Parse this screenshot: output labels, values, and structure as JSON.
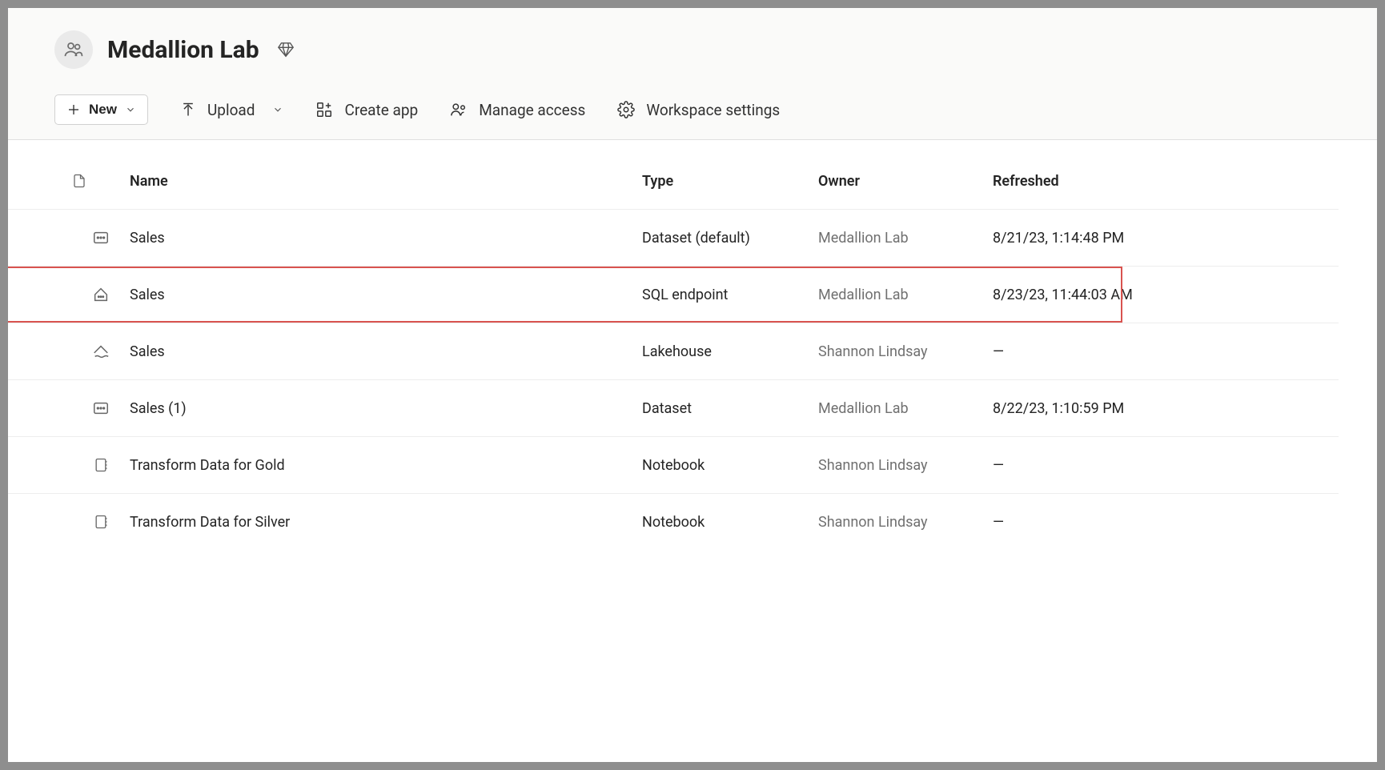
{
  "workspace": {
    "title": "Medallion Lab"
  },
  "toolbar": {
    "new_label": "New",
    "upload_label": "Upload",
    "create_app_label": "Create app",
    "manage_access_label": "Manage access",
    "workspace_settings_label": "Workspace settings"
  },
  "table": {
    "columns": {
      "name": "Name",
      "type": "Type",
      "owner": "Owner",
      "refreshed": "Refreshed"
    },
    "rows": [
      {
        "icon": "dataset",
        "name": "Sales",
        "type": "Dataset (default)",
        "owner": "Medallion Lab",
        "refreshed": "8/21/23, 1:14:48 PM",
        "highlight": false
      },
      {
        "icon": "sql-endpoint",
        "name": "Sales",
        "type": "SQL endpoint",
        "owner": "Medallion Lab",
        "refreshed": "8/23/23, 11:44:03 AM",
        "highlight": true
      },
      {
        "icon": "lakehouse",
        "name": "Sales",
        "type": "Lakehouse",
        "owner": "Shannon Lindsay",
        "refreshed": "—",
        "highlight": false
      },
      {
        "icon": "dataset",
        "name": "Sales (1)",
        "type": "Dataset",
        "owner": "Medallion Lab",
        "refreshed": "8/22/23, 1:10:59 PM",
        "highlight": false
      },
      {
        "icon": "notebook",
        "name": "Transform Data for Gold",
        "type": "Notebook",
        "owner": "Shannon Lindsay",
        "refreshed": "—",
        "highlight": false
      },
      {
        "icon": "notebook",
        "name": "Transform Data for Silver",
        "type": "Notebook",
        "owner": "Shannon Lindsay",
        "refreshed": "—",
        "highlight": false
      }
    ]
  }
}
